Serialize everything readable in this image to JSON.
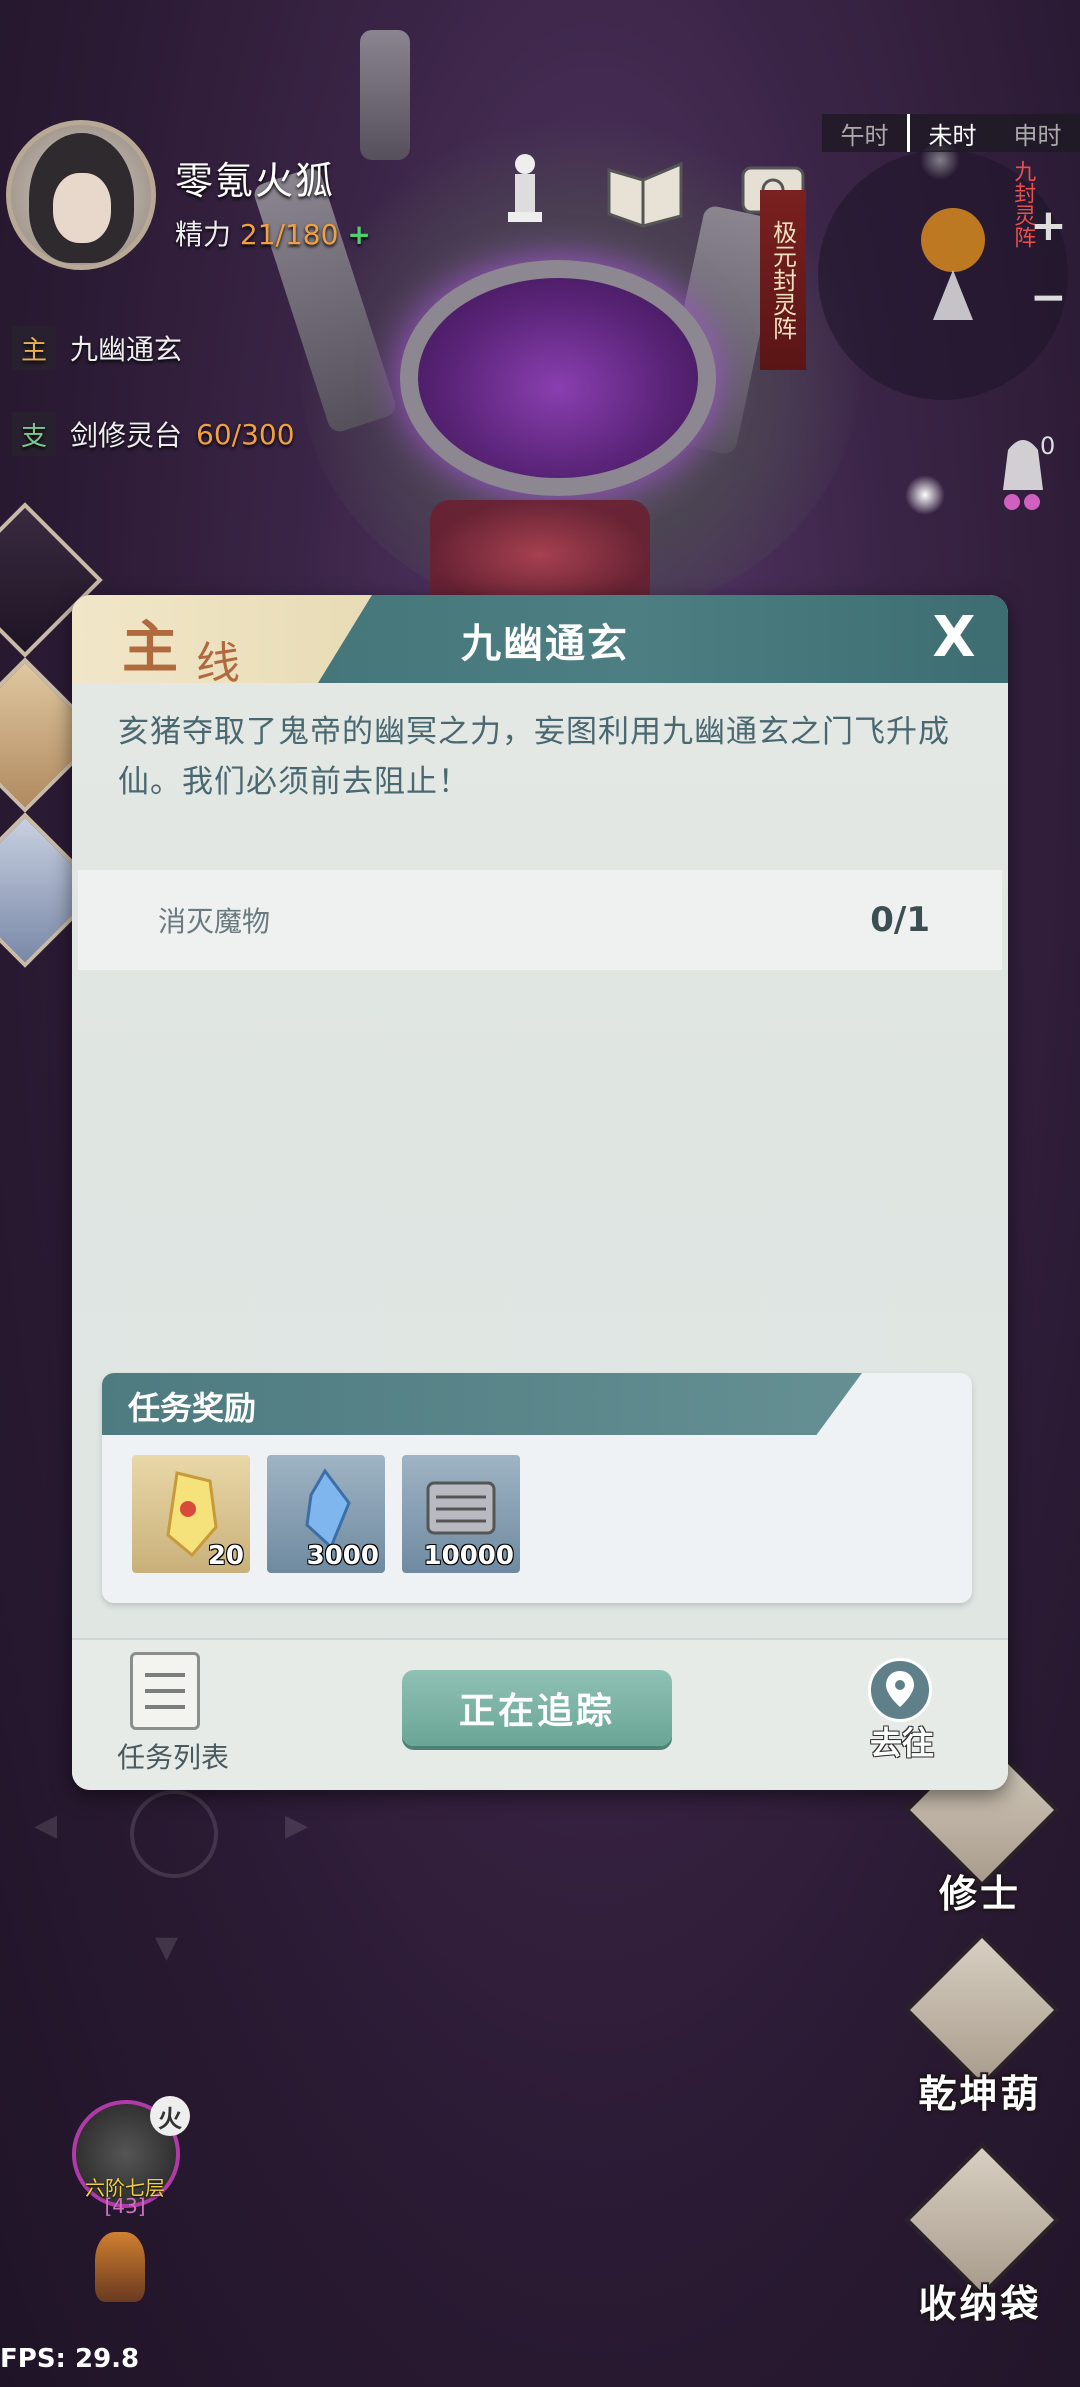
{
  "player": {
    "name": "零氪火狐",
    "energy_label": "精力",
    "energy_value": "21/180",
    "energy_plus": "+"
  },
  "quests": {
    "main_tag": "主",
    "main_name": "九幽通玄",
    "side_tag": "支",
    "side_name": "剑修灵台",
    "side_progress": "60/300"
  },
  "timebar": {
    "items": [
      "午时",
      "未时",
      "申时"
    ]
  },
  "minimap": {
    "label": "九封灵阵",
    "zoom_in": "+",
    "zoom_out": "−"
  },
  "banner": {
    "label": "极元封灵阵"
  },
  "notifications": {
    "count": "0"
  },
  "dialog": {
    "tab_big": "主",
    "tab_small": "线",
    "title": "九幽通玄",
    "close": "X",
    "description": "亥猪夺取了鬼帝的幽冥之力，妄图利用九幽通玄之门飞升成仙。我们必须前去阻止！",
    "objective_text": "消灭魔物",
    "objective_count": "0/1",
    "reward_title": "任务奖励",
    "rewards": [
      {
        "icon": "amber-talisman-icon",
        "qty": "20"
      },
      {
        "icon": "spirit-crystal-icon",
        "qty": "3000"
      },
      {
        "icon": "scroll-icon",
        "qty": "10000"
      }
    ],
    "list_label": "任务列表",
    "track_label": "正在追踪",
    "go_label": "去往"
  },
  "side_buttons": [
    "修士",
    "乾坤葫",
    "收纳袋"
  ],
  "realm": {
    "element": "火",
    "name": "六阶七层",
    "level": "[43]"
  },
  "fps": "FPS: 29.8",
  "colors": {
    "dialog_teal": "#4d7f82",
    "track_button": "#6aa595",
    "accent_orange": "#f0a040",
    "tab_text": "#b06a3e"
  }
}
